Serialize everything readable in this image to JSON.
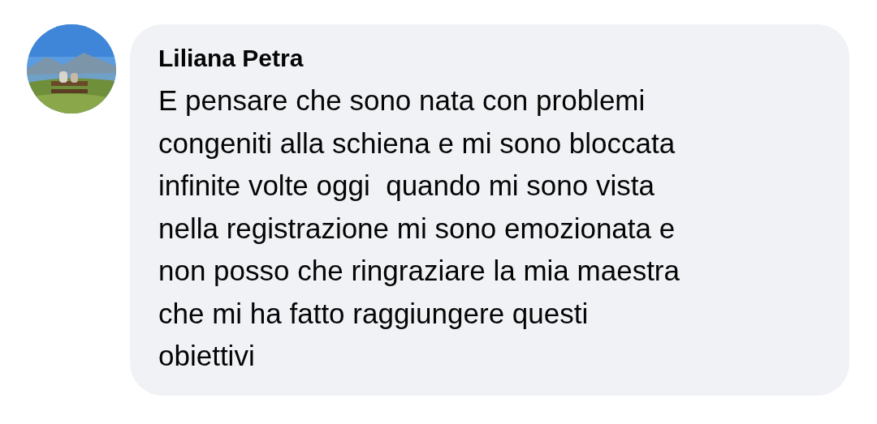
{
  "comment": {
    "author": "Liliana Petra",
    "text": "E pensare che sono nata con problemi\ncongeniti alla schiena e mi sono bloccata\ninfinite volte oggi  quando mi sono vista\nnella registrazione mi sono emozionata e\nnon posso che ringraziare la mia maestra\nche mi ha fatto raggiungere questi\nobiettivi"
  }
}
